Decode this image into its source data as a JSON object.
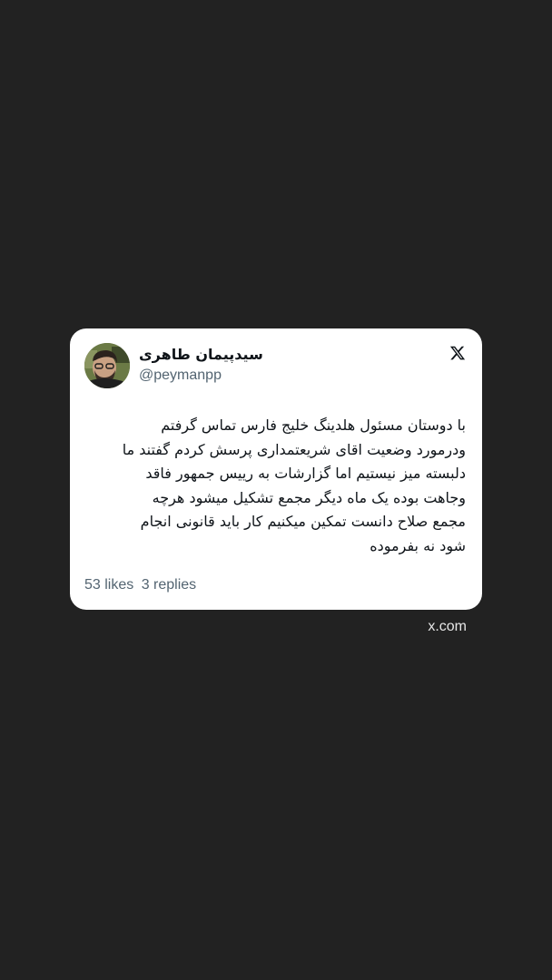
{
  "tweet": {
    "display_name": "سیدپیمان طاهری",
    "handle": "@peymanpp",
    "avatar_icon": "user-avatar",
    "platform_icon": "x-logo-icon",
    "text": "با دوستان مسئول هلدینگ خلیج فارس تماس گرفتم\nودرمورد وضعیت اقای شریعتمداری پرسش کردم گفتند ما\nدلبسته میز نیستیم اما گزارشات به رییس جمهور فاقد\nوجاهت بوده یک ماه دیگر مجمع تشکیل میشود هرچه\nمجمع صلاح دانست تمکین میکنیم کار باید قانونی انجام\nشود نه بفرموده",
    "likes_label": "53 likes",
    "replies_label": "3 replies"
  },
  "footer": {
    "source": "x.com"
  },
  "colors": {
    "background": "#222222",
    "card": "#ffffff",
    "text_primary": "#0f1419",
    "text_secondary": "#536471"
  }
}
